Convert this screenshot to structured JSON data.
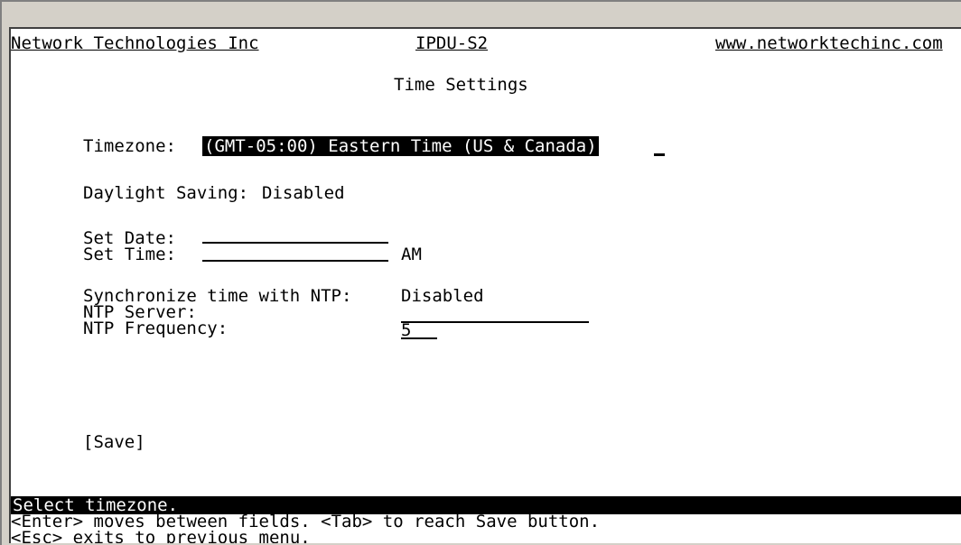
{
  "header": {
    "company": "Network Technologies Inc",
    "product": "IPDU-S2",
    "website": "www.networktechinc.com"
  },
  "page_title": "Time Settings",
  "timezone": {
    "label": "Timezone:",
    "value": "(GMT-05:00) Eastern Time (US & Canada)"
  },
  "daylight": {
    "label": "Daylight Saving:",
    "value": "Disabled"
  },
  "set_date": {
    "label": "Set Date:",
    "value": ""
  },
  "set_time": {
    "label": "Set Time:",
    "value": "",
    "ampm": "AM"
  },
  "ntp_sync": {
    "label": "Synchronize time with NTP:",
    "value": "Disabled"
  },
  "ntp_server": {
    "label": "NTP Server:",
    "value": ""
  },
  "ntp_frequency": {
    "label": "NTP Frequency:",
    "value": "5"
  },
  "save_button": "[Save]",
  "status": {
    "message": "Select timezone.",
    "help1": "<Enter> moves between fields. <Tab> to reach Save button.",
    "help2": "<Esc> exits to previous menu."
  }
}
